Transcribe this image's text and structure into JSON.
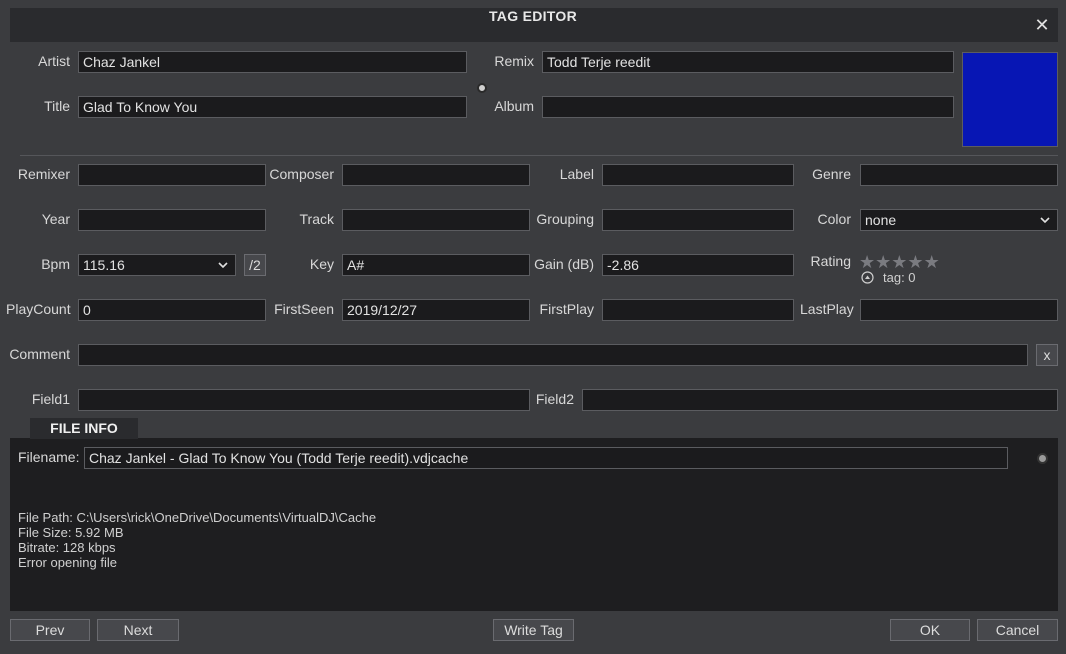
{
  "window": {
    "title": "TAG EDITOR",
    "close_glyph": "✕"
  },
  "tags": {
    "artist": {
      "label": "Artist",
      "value": "Chaz Jankel"
    },
    "title": {
      "label": "Title",
      "value": "Glad To Know You"
    },
    "remix": {
      "label": "Remix",
      "value": "Todd Terje reedit"
    },
    "album": {
      "label": "Album",
      "value": ""
    },
    "remixer": {
      "label": "Remixer",
      "value": ""
    },
    "composer": {
      "label": "Composer",
      "value": ""
    },
    "label_field": {
      "label": "Label",
      "value": ""
    },
    "genre": {
      "label": "Genre",
      "value": ""
    },
    "year": {
      "label": "Year",
      "value": ""
    },
    "track": {
      "label": "Track",
      "value": ""
    },
    "grouping": {
      "label": "Grouping",
      "value": ""
    },
    "color": {
      "label": "Color",
      "value": "none"
    },
    "bpm": {
      "label": "Bpm",
      "value": "115.16",
      "half_button": "/2"
    },
    "key": {
      "label": "Key",
      "value": "A#"
    },
    "gain": {
      "label": "Gain (dB)",
      "value": "-2.86"
    },
    "rating": {
      "label": "Rating",
      "stars": 0,
      "max_stars": 5,
      "tag_text": "tag: 0"
    },
    "playcount": {
      "label": "PlayCount",
      "value": "0"
    },
    "firstseen": {
      "label": "FirstSeen",
      "value": "2019/12/27"
    },
    "firstplay": {
      "label": "FirstPlay",
      "value": ""
    },
    "lastplay": {
      "label": "LastPlay",
      "value": ""
    },
    "comment": {
      "label": "Comment",
      "value": "",
      "clear_button": "x"
    },
    "field1": {
      "label": "Field1",
      "value": ""
    },
    "field2": {
      "label": "Field2",
      "value": ""
    }
  },
  "cover_color": "#0716b4",
  "file_info": {
    "tab_label": "FILE INFO",
    "filename_label": "Filename:",
    "filename": "Chaz Jankel - Glad To Know You (Todd Terje reedit).vdjcache",
    "path": "File Path: C:\\Users\\rick\\OneDrive\\Documents\\VirtualDJ\\Cache",
    "size": "File Size: 5.92 MB",
    "bitrate": "Bitrate: 128 kbps",
    "error": "Error opening file"
  },
  "buttons": {
    "prev": "Prev",
    "next": "Next",
    "write_tag": "Write Tag",
    "ok": "OK",
    "cancel": "Cancel"
  }
}
